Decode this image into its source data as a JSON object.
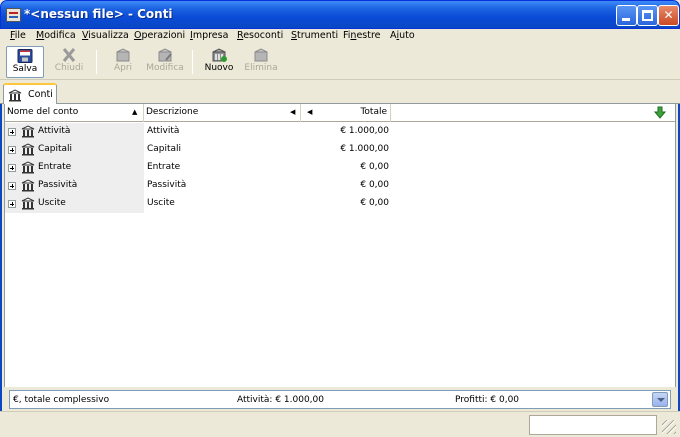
{
  "window": {
    "title": "*<nessun file> - Conti"
  },
  "menu": [
    {
      "accel": "F",
      "rest": "ile"
    },
    {
      "accel": "M",
      "rest": "odifica"
    },
    {
      "accel": "V",
      "rest": "isualizza"
    },
    {
      "accel": "O",
      "rest": "perazioni"
    },
    {
      "accel": "I",
      "rest": "mpresa"
    },
    {
      "accel": "R",
      "rest": "esoconti"
    },
    {
      "accel": "S",
      "rest": "trumenti"
    },
    {
      "accel": "F",
      "rest": "inestre"
    },
    {
      "accel": "A",
      "rest": "iuto"
    }
  ],
  "menu_prefix": {
    "finestre": "Fi",
    "finestre_accel": "n",
    "finestre_rest": "estre",
    "aiuto_prefix": "A",
    "aiuto_accel": "i",
    "aiuto_rest": "uto"
  },
  "toolbar": {
    "salva": "Salva",
    "chiudi": "Chiudi",
    "apri": "Apri",
    "modifica": "Modifica",
    "nuovo": "Nuovo",
    "elimina": "Elimina"
  },
  "tab": {
    "label": "Conti"
  },
  "columns": {
    "name": "Nome del conto",
    "description": "Descrizione",
    "total": "Totale"
  },
  "accounts": [
    {
      "name": "Attività",
      "description": "Attività",
      "total": "€ 1.000,00"
    },
    {
      "name": "Capitali",
      "description": "Capitali",
      "total": "€ 1.000,00"
    },
    {
      "name": "Entrate",
      "description": "Entrate",
      "total": "€ 0,00"
    },
    {
      "name": "Passività",
      "description": "Passività",
      "total": "€ 0,00"
    },
    {
      "name": "Uscite",
      "description": "Uscite",
      "total": "€ 0,00"
    }
  ],
  "summary": {
    "currency": "€, totale complessivo",
    "assets": "Attività: € 1.000,00",
    "profits": "Profitti: € 0,00"
  },
  "colors": {
    "titlebar": "#0A4BD6",
    "tab_accent": "#FFC83C",
    "name_column_bg": "#EEEEEE"
  }
}
